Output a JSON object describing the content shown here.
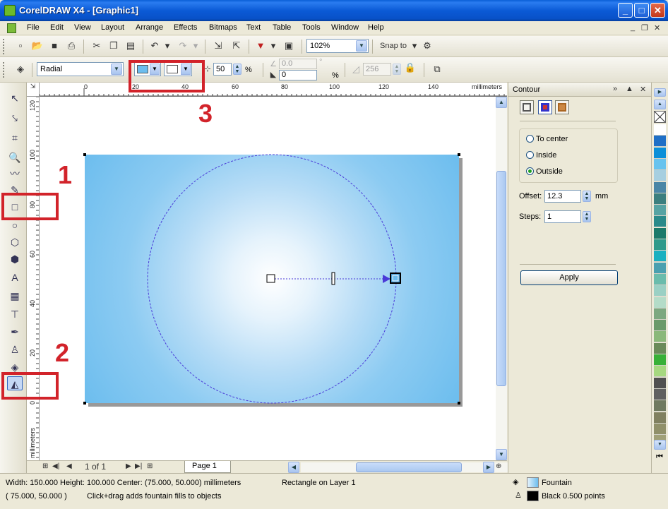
{
  "window": {
    "title": "CorelDRAW X4 - [Graphic1]",
    "buttons": [
      "_",
      "□",
      "✕"
    ]
  },
  "menu": {
    "items": [
      "File",
      "Edit",
      "View",
      "Layout",
      "Arrange",
      "Effects",
      "Bitmaps",
      "Text",
      "Table",
      "Tools",
      "Window",
      "Help"
    ],
    "mdi": [
      "_",
      "❐",
      "✕"
    ]
  },
  "standard_toolbar": {
    "zoom": "102%",
    "snap_to": "Snap to"
  },
  "property_bar": {
    "fill_type": "Radial",
    "midpoint": "50",
    "percent": "%",
    "angle": "0.0",
    "edge_pad": "0",
    "steps": "256",
    "colors": {
      "from": "#6cbdee",
      "to": "#ffffff"
    }
  },
  "ruler": {
    "h_labels": [
      "0",
      "20",
      "40",
      "60",
      "80",
      "100",
      "120",
      "140"
    ],
    "h_unit": "millimeters",
    "v_labels": [
      "120",
      "100",
      "80",
      "60",
      "40",
      "20",
      "0"
    ],
    "v_unit": "millimeters"
  },
  "page_nav": {
    "counter": "1 of 1",
    "tab": "Page 1"
  },
  "docker": {
    "title": "Contour",
    "radios": [
      {
        "label": "To center",
        "checked": false
      },
      {
        "label": "Inside",
        "checked": false
      },
      {
        "label": "Outside",
        "checked": true
      }
    ],
    "offset_label": "Offset:",
    "offset_value": "12.3",
    "offset_unit": "mm",
    "steps_label": "Steps:",
    "steps_value": "1",
    "apply": "Apply"
  },
  "palette": [
    "#ffffff",
    "#1f6fc6",
    "#0b8fd8",
    "#68c3ee",
    "#a6cfe0",
    "#4a86a6",
    "#3b7f7f",
    "#56a3a3",
    "#2a8a8a",
    "#1c7a6a",
    "#2f9a8a",
    "#1ab0c0",
    "#4aa0b0",
    "#6abcac",
    "#9ad0c4",
    "#b4dcc8",
    "#7ca880",
    "#6a9a6a",
    "#8ab87a",
    "#6a8a5a",
    "#38b038",
    "#a6d880",
    "#505050",
    "#606060",
    "#707a60",
    "#808060",
    "#90906a",
    "#a0a078"
  ],
  "status": {
    "line1": "Width: 150.000  Height: 100.000  Center: (75.000, 50.000)  millimeters",
    "object": "Rectangle on Layer 1",
    "line2_coords": "( 75.000, 50.000 )",
    "hint": "Click+drag adds fountain fills to objects",
    "fill_label": "Fountain",
    "outline_label": "Black  0.500 points"
  },
  "annotations": [
    "1",
    "2",
    "3"
  ]
}
